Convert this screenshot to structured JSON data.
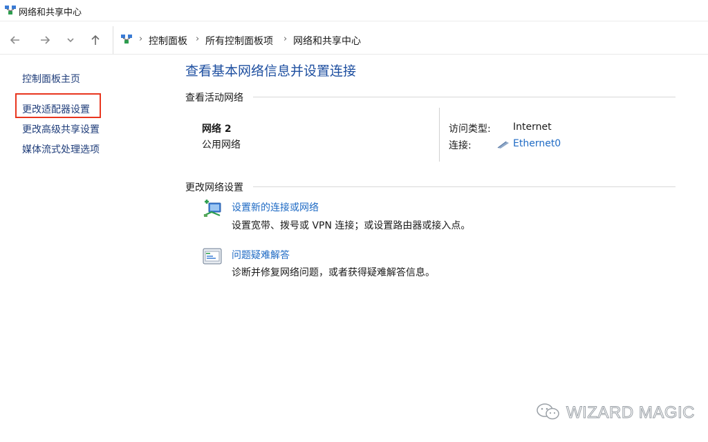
{
  "window": {
    "title": "网络和共享中心"
  },
  "navigation": {
    "back": "back-arrow-icon",
    "forward": "forward-arrow-icon",
    "recent": "chevron-down-icon",
    "up": "up-arrow-icon"
  },
  "breadcrumb": {
    "items": [
      "控制面板",
      "所有控制面板项",
      "网络和共享中心"
    ],
    "separator": "›"
  },
  "sidebar": {
    "items": [
      {
        "label": "控制面板主页"
      },
      {
        "label": "更改适配器设置",
        "highlighted": true
      },
      {
        "label": "更改高级共享设置"
      },
      {
        "label": "媒体流式处理选项"
      }
    ],
    "highlight_color": "#e8351e"
  },
  "main": {
    "heading": "查看基本网络信息并设置连接",
    "active_section": {
      "title": "查看活动网络",
      "network_name": "网络 2",
      "network_type": "公用网络",
      "access_type_label": "访问类型:",
      "access_type_value": "Internet",
      "connection_label": "连接:",
      "connection_value": "Ethernet0"
    },
    "change_section": {
      "title": "更改网络设置",
      "tasks": [
        {
          "link": "设置新的连接或网络",
          "description": "设置宽带、拨号或 VPN 连接；或设置路由器或接入点。",
          "icon": "new-connection-icon"
        },
        {
          "link": "问题疑难解答",
          "description": "诊断并修复网络问题，或者获得疑难解答信息。",
          "icon": "troubleshoot-icon"
        }
      ]
    }
  },
  "watermark": {
    "text": "WIZARD MAGIC"
  },
  "colors": {
    "link": "#1e6ac4",
    "heading": "#1e4fa0",
    "sidebar_link": "#1f3d7a"
  }
}
